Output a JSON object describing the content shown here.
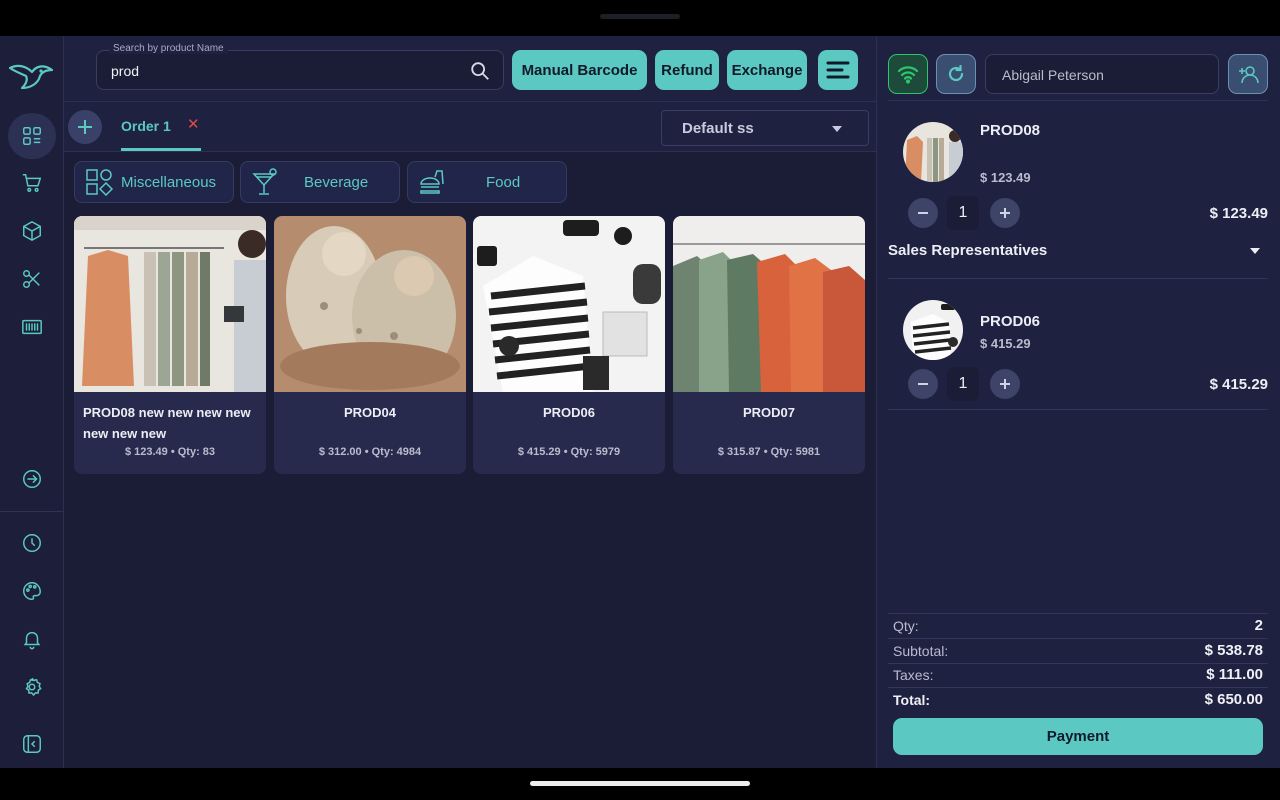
{
  "search": {
    "label": "Search by product Name",
    "value": "prod"
  },
  "toolbar": {
    "manual_barcode": "Manual Barcode",
    "refund": "Refund",
    "exchange": "Exchange"
  },
  "orders": {
    "tab_label": "Order 1",
    "close_glyph": "✕"
  },
  "pricelist": {
    "selected": "Default ss"
  },
  "categories": [
    {
      "label": "Miscellaneous",
      "icon": "shapes-icon"
    },
    {
      "label": "Beverage",
      "icon": "cocktail-icon"
    },
    {
      "label": "Food",
      "icon": "burger-icon"
    }
  ],
  "products": [
    {
      "title": "PROD08 new new new new new new new",
      "meta": "$ 123.49 • Qty: 83"
    },
    {
      "title": "PROD04",
      "meta": "$ 312.00 • Qty: 4984"
    },
    {
      "title": "PROD06",
      "meta": "$ 415.29 • Qty: 5979"
    },
    {
      "title": "PROD07",
      "meta": "$ 315.87 • Qty: 5981"
    }
  ],
  "customer": {
    "name": "Abigail Peterson"
  },
  "cart_lines": [
    {
      "name": "PROD08",
      "price": "$ 123.49",
      "qty": "1",
      "total": "$ 123.49"
    },
    {
      "name": "PROD06",
      "price": "$ 415.29",
      "qty": "1",
      "total": "$ 415.29"
    }
  ],
  "sales_rep_label": "Sales Representatives",
  "summary": {
    "qty_label": "Qty:",
    "qty_value": "2",
    "subtotal_label": "Subtotal:",
    "subtotal_value": "$ 538.78",
    "taxes_label": "Taxes:",
    "taxes_value": "$ 111.00",
    "total_label": "Total:",
    "total_value": "$ 650.00"
  },
  "payment_label": "Payment",
  "colors": {
    "accent": "#5bc9c2",
    "background": "#1f2140",
    "danger": "#e04a4a",
    "online": "#2ec46a"
  },
  "sidebar_icons": [
    "dashboard-icon",
    "cart-icon",
    "box-icon",
    "scissors-icon",
    "barcode-icon",
    "login-icon",
    "clock-icon",
    "palette-icon",
    "bell-icon",
    "gear-icon",
    "collapse-icon"
  ]
}
